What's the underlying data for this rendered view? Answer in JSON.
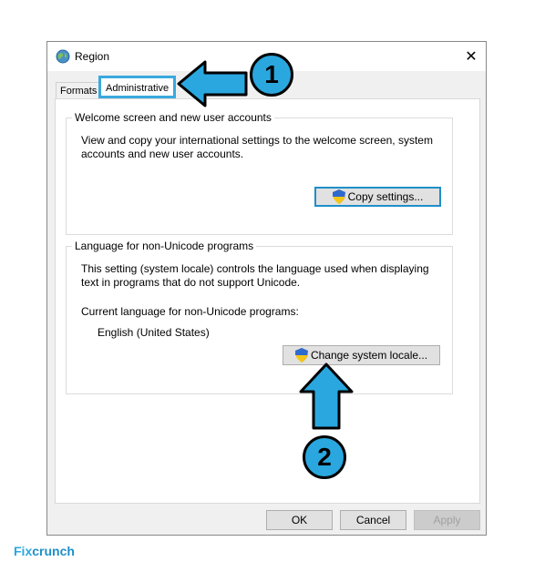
{
  "window": {
    "title": "Region",
    "close_glyph": "✕"
  },
  "tabs": [
    {
      "label": "Formats"
    },
    {
      "label": "Administrative"
    }
  ],
  "welcome_group": {
    "title": "Welcome screen and new user accounts",
    "description_line1": "View and copy your international settings to the welcome screen, system",
    "description_line2": "accounts and new user accounts.",
    "copy_button": "Copy settings..."
  },
  "locale_group": {
    "title": "Language for non-Unicode programs",
    "description_line1": "This setting (system locale) controls the language used when displaying",
    "description_line2": "text in programs that do not support Unicode.",
    "current_label": "Current language for non-Unicode programs:",
    "current_value": "English (United States)",
    "change_button": "Change system locale..."
  },
  "footer": {
    "ok": "OK",
    "cancel": "Cancel",
    "apply": "Apply"
  },
  "annotations": {
    "marker1": "1",
    "marker2": "2"
  },
  "logo": {
    "prefix": "Fix",
    "suffix": "crunch"
  },
  "colors": {
    "accent": "#2aa7df",
    "highlight_border": "#3aa9dd"
  },
  "icons": {
    "title": "globe-icon",
    "shield": "uac-shield-icon"
  }
}
